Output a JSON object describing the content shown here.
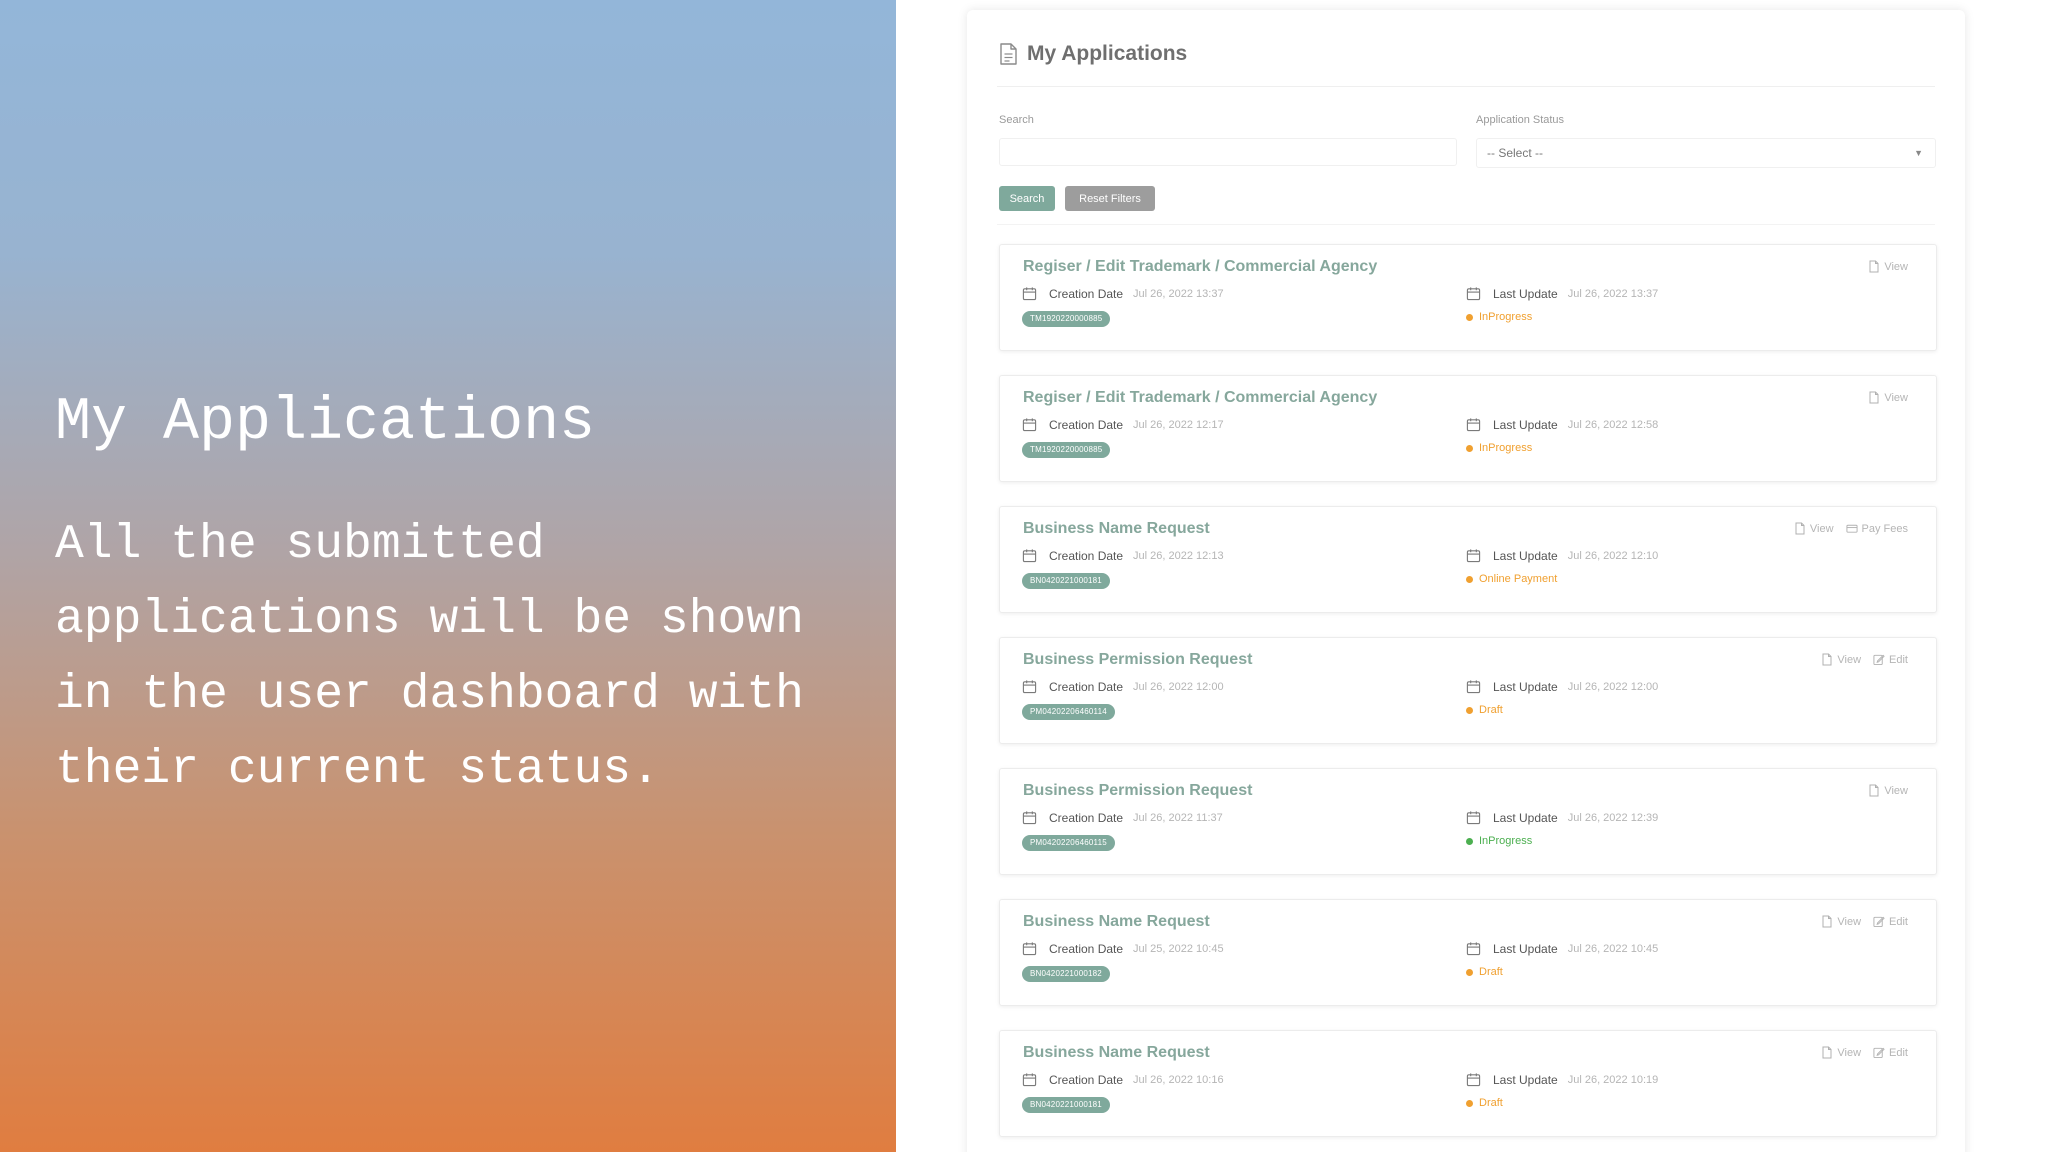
{
  "slide": {
    "title": "My Applications",
    "body": "All the submitted applications will be shown in the user dashboard with their current status."
  },
  "panel": {
    "title": "My Applications",
    "title_icon": "document-icon",
    "search": {
      "label": "Search",
      "value": "",
      "placeholder": ""
    },
    "status_filter": {
      "label": "Application Status",
      "selected": "-- Select --"
    },
    "buttons": {
      "search": "Search",
      "reset": "Reset Filters"
    },
    "labels": {
      "creation_date": "Creation Date",
      "last_update": "Last Update"
    },
    "applications": [
      {
        "title": "Regiser / Edit Trademark / Commercial Agency",
        "created": "Jul 26, 2022 13:37",
        "updated": "Jul 26, 2022 13:37",
        "ref": "TM1920220000885",
        "status": "InProgress",
        "actions": [
          "View"
        ]
      },
      {
        "title": "Regiser / Edit Trademark / Commercial Agency",
        "created": "Jul 26, 2022 12:17",
        "updated": "Jul 26, 2022 12:58",
        "ref": "TM1920220000885",
        "status": "InProgress",
        "actions": [
          "View"
        ]
      },
      {
        "title": "Business Name Request",
        "created": "Jul 26, 2022 12:13",
        "updated": "Jul 26, 2022 12:10",
        "ref": "BN0420221000181",
        "status": "Online Payment",
        "actions": [
          "View",
          "Pay Fees"
        ]
      },
      {
        "title": "Business Permission Request",
        "created": "Jul 26, 2022 12:00",
        "updated": "Jul 26, 2022 12:00",
        "ref": "PM04202206460114",
        "status": "Draft",
        "actions": [
          "View",
          "Edit"
        ]
      },
      {
        "title": "Business Permission Request",
        "created": "Jul 26, 2022 11:37",
        "updated": "Jul 26, 2022 12:39",
        "ref": "PM04202206460115",
        "status": "InProgress",
        "actions": [
          "View"
        ]
      },
      {
        "title": "Business Name Request",
        "created": "Jul 25, 2022 10:45",
        "updated": "Jul 26, 2022 10:45",
        "ref": "BN0420221000182",
        "status": "Draft",
        "actions": [
          "View",
          "Edit"
        ]
      },
      {
        "title": "Business Name Request",
        "created": "Jul 26, 2022 10:16",
        "updated": "Jul 26, 2022 10:19",
        "ref": "BN0420221000181",
        "status": "Draft",
        "actions": [
          "View",
          "Edit"
        ]
      }
    ]
  },
  "colors": {
    "accent": "#7fa99c",
    "title_green": "#86a79c",
    "reset_gray": "#9d9d9d",
    "status_orange": "#f0a030",
    "status_green": "#4caf50",
    "gradient_top": "#93b6d9",
    "gradient_bottom": "#e07d40"
  },
  "icons": {
    "calendar": "calendar-icon",
    "view": "document-icon",
    "edit": "edit-icon",
    "pay": "credit-card-icon"
  }
}
